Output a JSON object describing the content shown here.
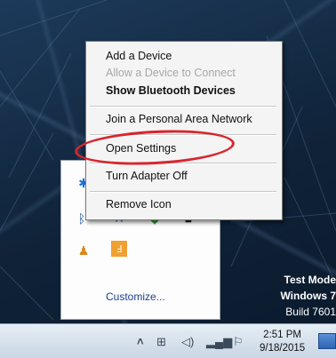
{
  "context_menu": {
    "items": [
      {
        "label": "Add a Device",
        "enabled": true,
        "bold": false
      },
      {
        "label": "Allow a Device to Connect",
        "enabled": false,
        "bold": false
      },
      {
        "label": "Show Bluetooth Devices",
        "enabled": true,
        "bold": true
      },
      {
        "label": "Join a Personal Area Network",
        "enabled": true,
        "bold": false
      },
      {
        "label": "Open Settings",
        "enabled": true,
        "bold": false,
        "circled": true
      },
      {
        "label": "Turn Adapter Off",
        "enabled": true,
        "bold": false
      },
      {
        "label": "Remove Icon",
        "enabled": true,
        "bold": false
      }
    ]
  },
  "overflow_panel": {
    "icons": [
      "bluetooth-icon",
      "network-icon",
      "shield-icon",
      "square-app-icon",
      "person-icon",
      "package-icon",
      "orange-app-icon",
      "app-icon"
    ],
    "customize_label": "Customize..."
  },
  "watermark": {
    "line1": "Test Mode",
    "line2": "Windows 7",
    "line3": "Build 7601"
  },
  "taskbar": {
    "tray_icons": [
      "show-hidden-icons-chevron",
      "network-icon",
      "speaker-icon",
      "signal-icon",
      "flag-icon"
    ],
    "time": "2:51 PM",
    "date": "9/18/2015"
  },
  "colors": {
    "highlight_ellipse": "#d8252e",
    "desktop": "#142a44",
    "link": "#1a3f8c"
  }
}
